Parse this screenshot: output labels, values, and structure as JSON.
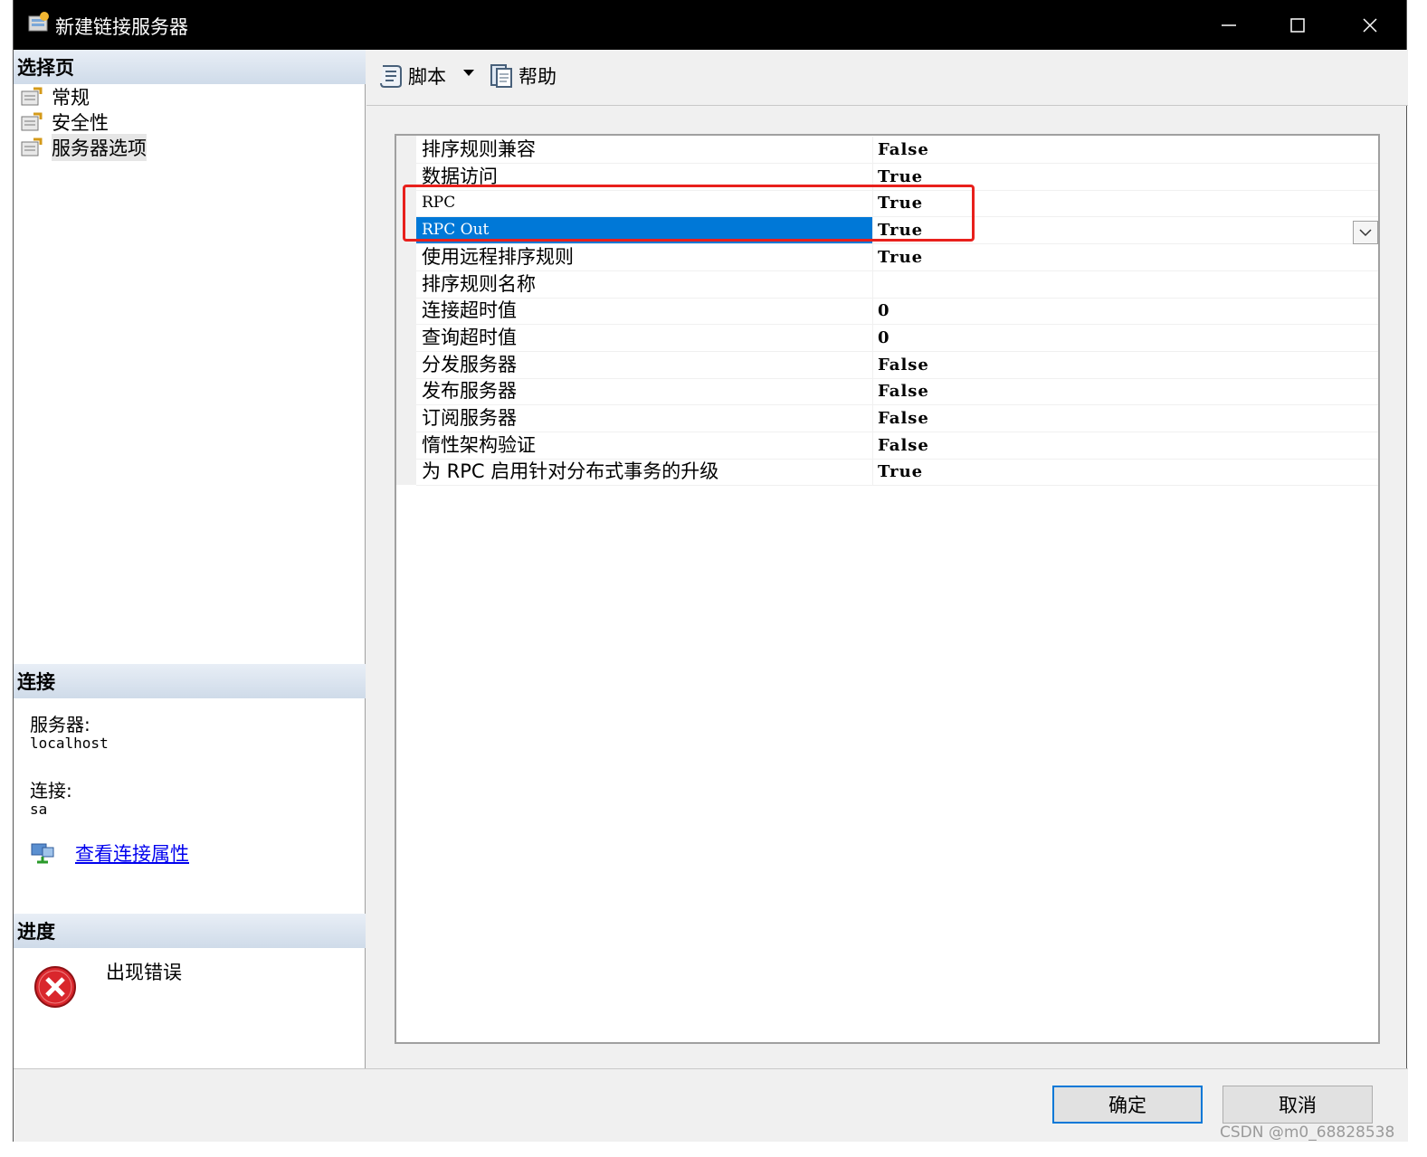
{
  "window": {
    "title": "新建链接服务器"
  },
  "left": {
    "select_page_header": "选择页",
    "pages": [
      {
        "label": "常规",
        "selected": false
      },
      {
        "label": "安全性",
        "selected": false
      },
      {
        "label": "服务器选项",
        "selected": true
      }
    ],
    "connection_header": "连接",
    "server_label": "服务器:",
    "server_value": "localhost",
    "connection_label": "连接:",
    "connection_value": "sa",
    "view_props_link": "查看连接属性",
    "progress_header": "进度",
    "progress_status": "出现错误"
  },
  "toolbar": {
    "script_label": "脚本",
    "help_label": "帮助"
  },
  "properties": [
    {
      "name": "排序规则兼容",
      "value": "False"
    },
    {
      "name": "数据访问",
      "value": "True"
    },
    {
      "name": "RPC",
      "value": "True"
    },
    {
      "name": "RPC Out",
      "value": "True"
    },
    {
      "name": "使用远程排序规则",
      "value": "True"
    },
    {
      "name": "排序规则名称",
      "value": ""
    },
    {
      "name": "连接超时值",
      "value": "0"
    },
    {
      "name": "查询超时值",
      "value": "0"
    },
    {
      "name": "分发服务器",
      "value": "False"
    },
    {
      "name": "发布服务器",
      "value": "False"
    },
    {
      "name": "订阅服务器",
      "value": "False"
    },
    {
      "name": "惰性架构验证",
      "value": "False"
    },
    {
      "name": "为 RPC 启用针对分布式事务的升级",
      "value": "True"
    }
  ],
  "buttons": {
    "ok": "确定",
    "cancel": "取消"
  },
  "watermark": "CSDN @m0_68828538",
  "colors": {
    "selection": "#0078d7",
    "highlight_box": "#e8201c",
    "link": "#0000ee"
  }
}
